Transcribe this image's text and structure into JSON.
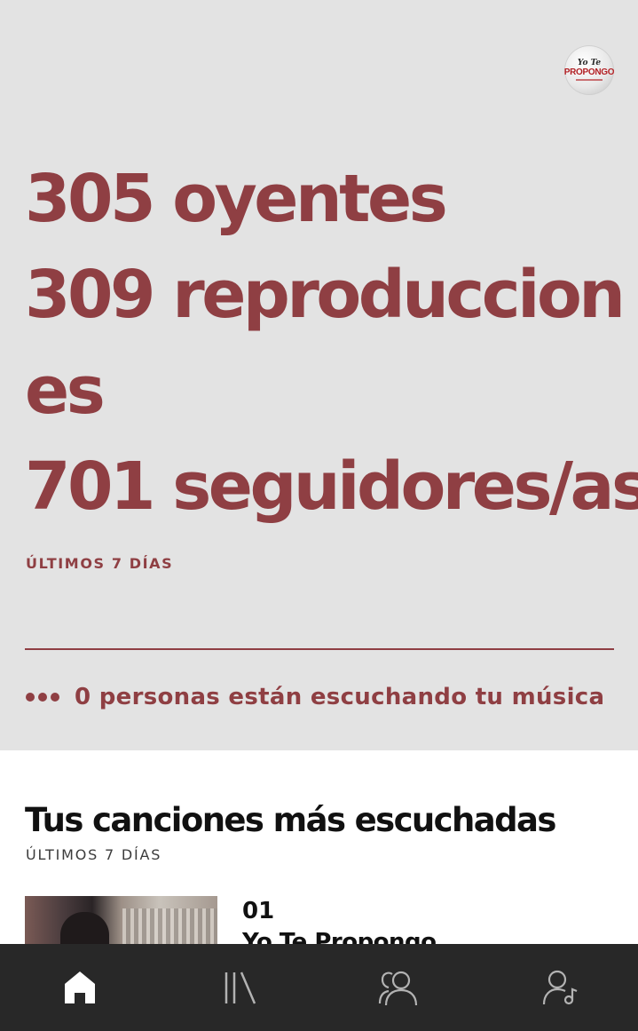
{
  "profile": {
    "avatar_icon": "artist-logo-icon",
    "logo_line1": "Yo Te",
    "logo_line2": "PROPONGO"
  },
  "stats": {
    "listeners": "305 oyentes",
    "streams_line1": "309 reproduccion",
    "streams_line2": "es",
    "followers": "701 seguidores/as",
    "period": "ÚLTIMOS 7 DÍAS"
  },
  "live": {
    "icon": "three-dots-icon",
    "text": "0 personas están escuchando tu música"
  },
  "top_songs": {
    "title": "Tus canciones más escuchadas",
    "period": "ÚLTIMOS 7 DÍAS",
    "items": [
      {
        "rank": "01",
        "name": "Yo Te Propongo"
      }
    ]
  },
  "nav": {
    "items": [
      {
        "name": "home",
        "icon": "home-icon",
        "active": true
      },
      {
        "name": "library",
        "icon": "library-icon",
        "active": false
      },
      {
        "name": "audience",
        "icon": "audience-icon",
        "active": false
      },
      {
        "name": "profile",
        "icon": "artist-profile-icon",
        "active": false
      }
    ]
  },
  "colors": {
    "accent": "#8f3f43",
    "hero_bg": "#e3e3e3",
    "nav_bg": "#282828",
    "nav_icon_active": "#ffffff",
    "nav_icon_inactive": "#b3b3b3"
  }
}
